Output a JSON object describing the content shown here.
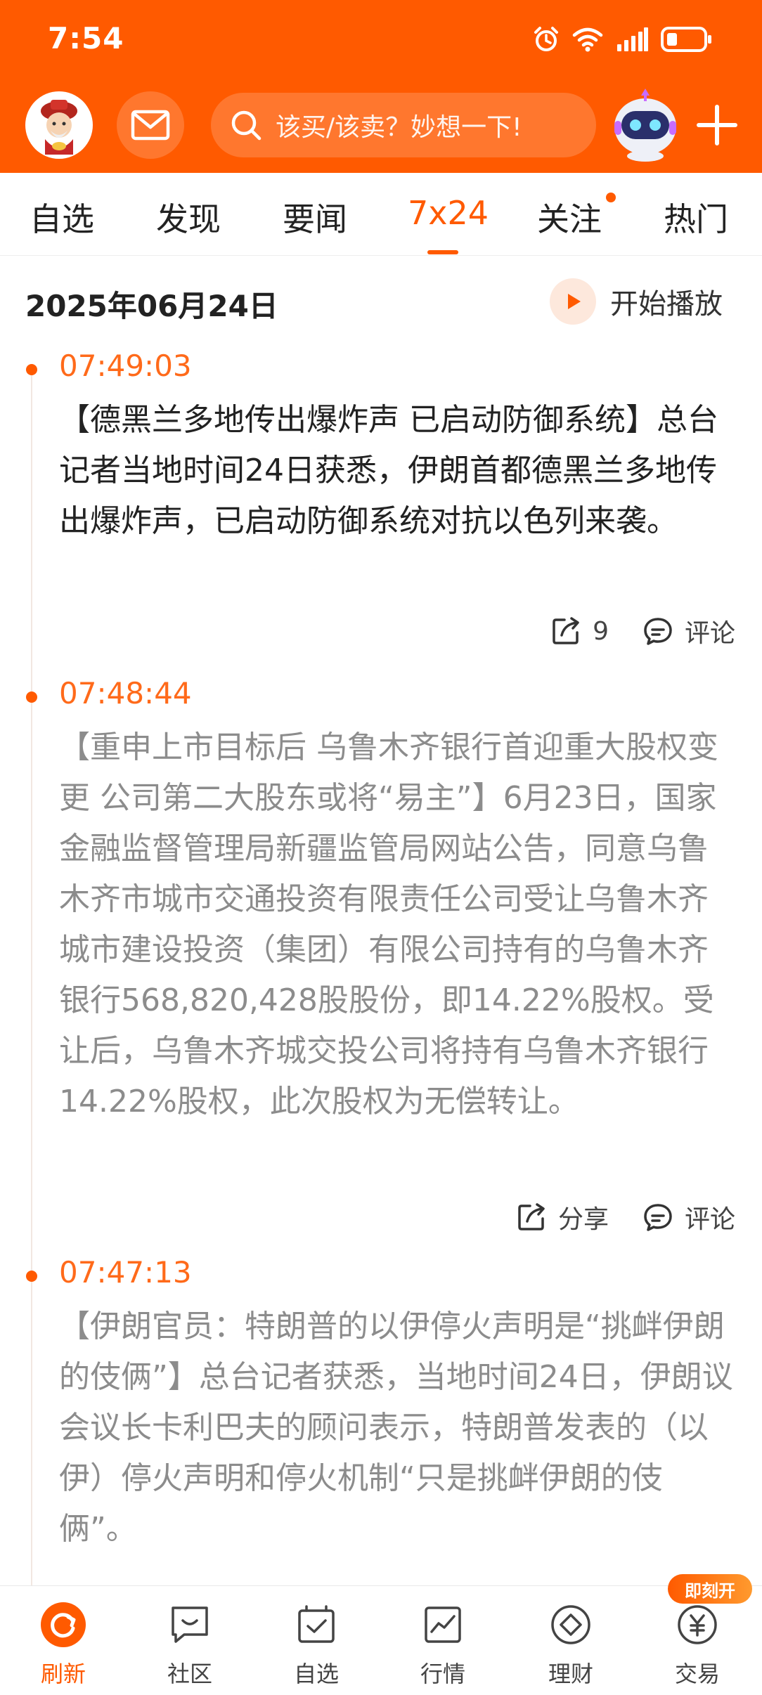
{
  "status": {
    "time": "7:54"
  },
  "header": {
    "search_placeholder": "该买/该卖？妙想一下!"
  },
  "tabs": [
    {
      "label": "自选"
    },
    {
      "label": "发现"
    },
    {
      "label": "要闻"
    },
    {
      "label": "7x24",
      "active": true
    },
    {
      "label": "关注",
      "has_dot": true
    },
    {
      "label": "热门"
    }
  ],
  "date": "2025年06月24日",
  "play_label": "开始播放",
  "news": [
    {
      "time": "07:49:03",
      "text": "【德黑兰多地传出爆炸声 已启动防御系统】总台记者当地时间24日获悉，伊朗首都德黑兰多地传出爆炸声，已启动防御系统对抗以色列来袭。",
      "share": "9",
      "comment": "评论"
    },
    {
      "time": "07:48:44",
      "text": "【重申上市目标后 乌鲁木齐银行首迎重大股权变更 公司第二大股东或将“易主”】6月23日，国家金融监督管理局新疆监管局网站公告，同意乌鲁木齐市城市交通投资有限责任公司受让乌鲁木齐城市建设投资（集团）有限公司持有的乌鲁木齐银行568,820,428股股份，即14.22%股权。受让后，乌鲁木齐城交投公司将持有乌鲁木齐银行14.22%股权，此次股权为无偿转让。",
      "share": "分享",
      "comment": "评论"
    },
    {
      "time": "07:47:13",
      "text": "【伊朗官员：特朗普的以伊停火声明是“挑衅伊朗的伎俩”】总台记者获悉，当地时间24日，伊朗议会议长卡利巴夫的顾问表示，特朗普发表的（以伊）停火声明和停火机制“只是挑衅伊朗的伎俩”。"
    }
  ],
  "bottom_nav": [
    {
      "label": "刷新",
      "icon": "refresh-icon",
      "active": true
    },
    {
      "label": "社区",
      "icon": "community-icon"
    },
    {
      "label": "自选",
      "icon": "watchlist-icon"
    },
    {
      "label": "行情",
      "icon": "market-icon"
    },
    {
      "label": "理财",
      "icon": "finance-icon"
    },
    {
      "label": "交易",
      "icon": "trade-icon"
    }
  ],
  "badge": "即刻开",
  "colors": {
    "brand": "#ff5a00",
    "read_text": "#8c8c8c"
  }
}
